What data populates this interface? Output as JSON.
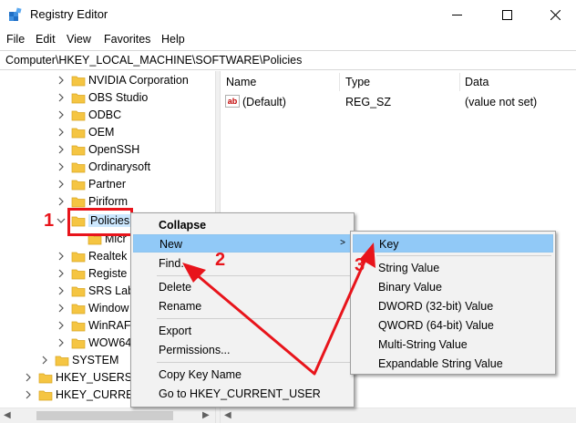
{
  "window": {
    "title": "Registry Editor"
  },
  "menubar": [
    "File",
    "Edit",
    "View",
    "Favorites",
    "Help"
  ],
  "address": "Computer\\HKEY_LOCAL_MACHINE\\SOFTWARE\\Policies",
  "tree": {
    "items": [
      {
        "label": "NVIDIA Corporation"
      },
      {
        "label": "OBS Studio"
      },
      {
        "label": "ODBC"
      },
      {
        "label": "OEM"
      },
      {
        "label": "OpenSSH"
      },
      {
        "label": "Ordinarysoft"
      },
      {
        "label": "Partner"
      },
      {
        "label": "Piriform"
      },
      {
        "label": "Policies"
      },
      {
        "label": "Micr"
      },
      {
        "label": "Realtek"
      },
      {
        "label": "Registe"
      },
      {
        "label": "SRS Lab"
      },
      {
        "label": "Window"
      },
      {
        "label": "WinRAF"
      },
      {
        "label": "WOW64"
      },
      {
        "label": "SYSTEM"
      },
      {
        "label": "HKEY_USERS"
      },
      {
        "label": "HKEY_CURREN"
      }
    ]
  },
  "list": {
    "columns": [
      "Name",
      "Type",
      "Data"
    ],
    "rows": [
      {
        "name": "(Default)",
        "type": "REG_SZ",
        "data": "(value not set)"
      }
    ]
  },
  "context_menu": {
    "items": [
      "Collapse",
      "New",
      "Find...",
      "Delete",
      "Rename",
      "Export",
      "Permissions...",
      "Copy Key Name",
      "Go to HKEY_CURRENT_USER"
    ]
  },
  "submenu": {
    "items": [
      "Key",
      "String Value",
      "Binary Value",
      "DWORD (32-bit) Value",
      "QWORD (64-bit) Value",
      "Multi-String Value",
      "Expandable String Value"
    ]
  },
  "annotations": {
    "step1": "1",
    "step2": "2",
    "step3": "3"
  },
  "colors": {
    "accent_red": "#e8141b",
    "highlight": "#91c9f7",
    "selection": "#cce8ff",
    "folder": "#f5c542"
  }
}
